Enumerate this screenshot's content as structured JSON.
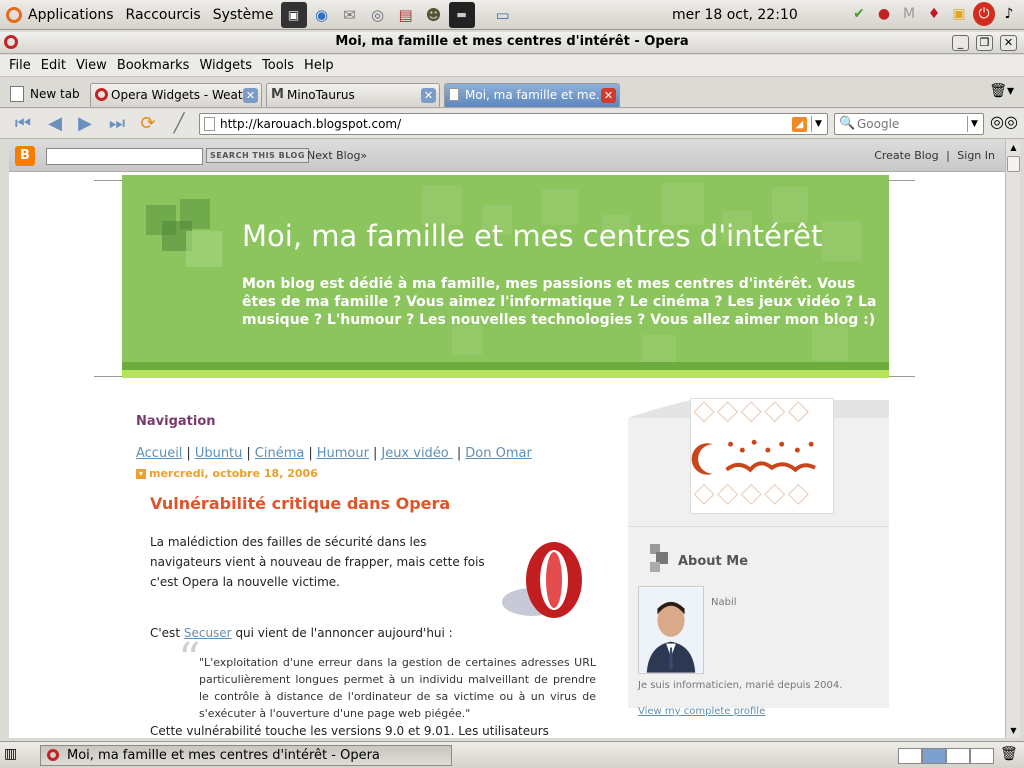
{
  "top_panel": {
    "menus": [
      "Applications",
      "Raccourcis",
      "Système"
    ],
    "clock": "mer 18 oct, 22:10"
  },
  "window": {
    "title": "Moi, ma famille et mes centres d'intérêt - Opera"
  },
  "menubar": [
    "File",
    "Edit",
    "View",
    "Bookmarks",
    "Widgets",
    "Tools",
    "Help"
  ],
  "tabs": {
    "new_tab_label": "New tab",
    "items": [
      {
        "label": "Opera Widgets - Weat..."
      },
      {
        "label": "MinoTaurus"
      },
      {
        "label": "Moi, ma famille et me..."
      }
    ]
  },
  "toolbar": {
    "address": "http://karouach.blogspot.com/",
    "search_placeholder": "Google"
  },
  "blogger_navbar": {
    "logo": "B",
    "search_button": "SEARCH THIS BLOG",
    "next_blog": "Next Blog»",
    "create_blog": "Create Blog",
    "sign_in": "Sign In",
    "separator": "|"
  },
  "blog": {
    "title": "Moi, ma famille et mes centres d'intérêt",
    "description": "Mon blog est dédié à ma famille, mes passions et mes centres d'intérêt. Vous êtes de ma famille ? Vous aimez l'informatique ? Le cinéma ? Les jeux vidéo ? La musique ? L'humour ? Les nouvelles technologies ? Vous allez aimer mon blog :)"
  },
  "navigation": {
    "heading": "Navigation",
    "links": [
      "Accueil",
      "Ubuntu",
      "Cinéma",
      "Humour",
      "Jeux vidéo ",
      "Don Omar"
    ],
    "separator": "|"
  },
  "post": {
    "date": "mercredi, octobre 18, 2006",
    "title": "Vulnérabilité critique dans Opera",
    "p1": "La malédiction des failles de sécurité dans les navigateurs vient à nouveau de frapper, mais cette fois c'est Opera la nouvelle victime.",
    "p2_prefix": "C'est ",
    "p2_link": "Secuser",
    "p2_suffix": " qui vient de l'annoncer aujourd'hui :",
    "quote": "\"L'exploitation d'une erreur dans la gestion de certaines adresses URL particulièrement longues permet à un individu malveillant de prendre le contrôle à distance de l'ordinateur de sa victime ou à un virus de s'exécuter à l'ouverture d'une page web piégée.\"",
    "p3": "Cette vulnérabilité touche les versions 9.0 et 9.01. Les utilisateurs"
  },
  "sidebar": {
    "about_heading": "About Me",
    "profile_name": "Nabil",
    "profile_bio": "Je suis informaticien, marié depuis 2004.",
    "profile_link": "View my complete profile"
  },
  "taskbar": {
    "task_label": "Moi, ma famille et mes centres d'intérêt - Opera"
  },
  "colors": {
    "header_green": "#8cc45e",
    "post_title": "#e0542a",
    "link": "#5c8fb7",
    "date": "#eaa02a",
    "nav_heading": "#7b3a6c",
    "active_tab": "#6b92c6"
  }
}
